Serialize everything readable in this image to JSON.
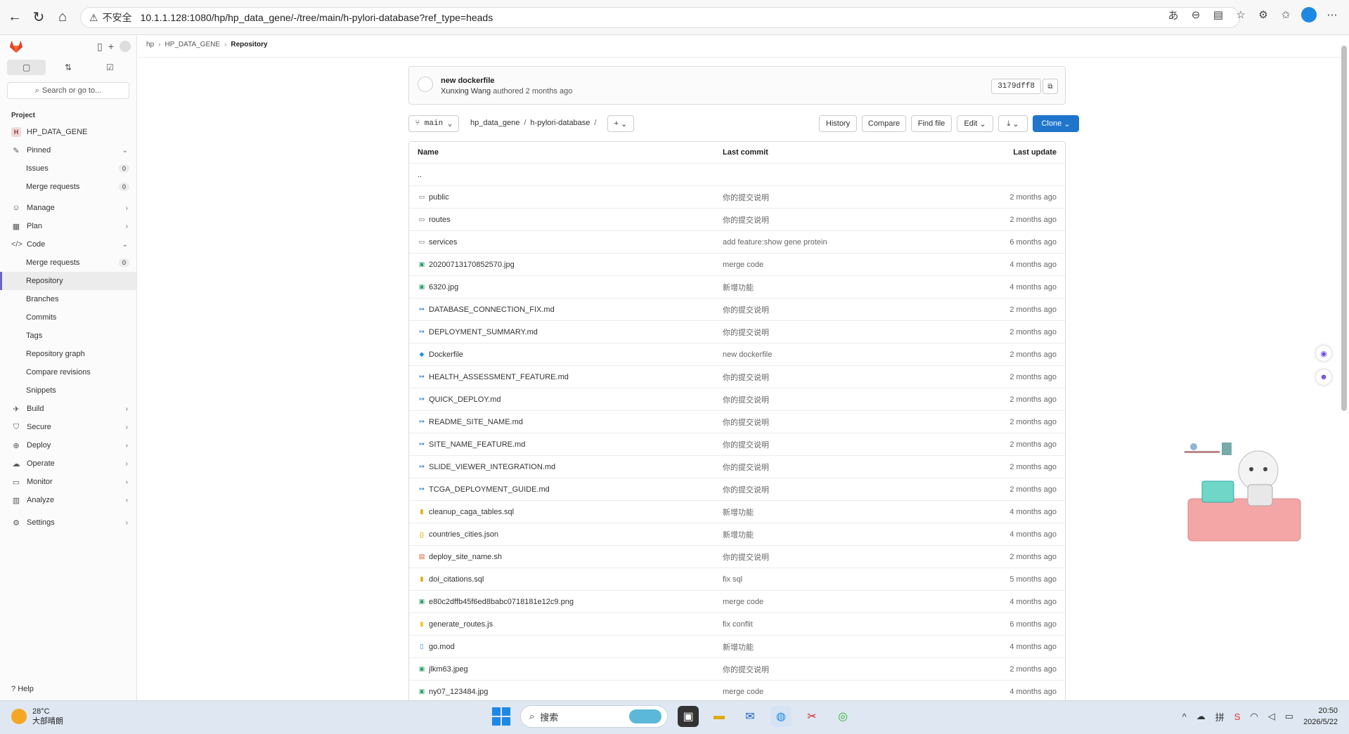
{
  "browser": {
    "insecure_label": "不安全",
    "url": "10.1.1.128:1080/hp/hp_data_gene/-/tree/main/h-pylori-database?ref_type=heads"
  },
  "sidebar": {
    "search_placeholder": "Search or go to...",
    "section_label": "Project",
    "project_initial": "H",
    "project_name": "HP_DATA_GENE",
    "pinned": "Pinned",
    "pinned_items": [
      {
        "label": "Issues",
        "count": "0"
      },
      {
        "label": "Merge requests",
        "count": "0"
      }
    ],
    "manage": "Manage",
    "plan": "Plan",
    "code": "Code",
    "code_items": [
      {
        "label": "Merge requests",
        "count": "0"
      },
      {
        "label": "Repository"
      },
      {
        "label": "Branches"
      },
      {
        "label": "Commits"
      },
      {
        "label": "Tags"
      },
      {
        "label": "Repository graph"
      },
      {
        "label": "Compare revisions"
      },
      {
        "label": "Snippets"
      }
    ],
    "build": "Build",
    "secure": "Secure",
    "deploy": "Deploy",
    "operate": "Operate",
    "monitor": "Monitor",
    "analyze": "Analyze",
    "settings": "Settings",
    "help": "Help"
  },
  "breadcrumb": {
    "items": [
      "hp",
      "HP_DATA_GENE",
      "Repository"
    ]
  },
  "commit": {
    "title": "new dockerfile",
    "author": "Xunxing Wang",
    "meta": "authored 2 months ago",
    "sha": "3179dff8"
  },
  "toolbar": {
    "branch": "main",
    "path_root": "hp_data_gene",
    "path_dir": "h-pylori-database",
    "history": "History",
    "compare": "Compare",
    "find_file": "Find file",
    "edit": "Edit",
    "clone": "Clone"
  },
  "table": {
    "headers": {
      "name": "Name",
      "commit": "Last commit",
      "date": "Last update"
    },
    "parent": "..",
    "rows": [
      {
        "name": "public",
        "type": "folder",
        "commit": "你的提交说明",
        "date": "2 months ago"
      },
      {
        "name": "routes",
        "type": "folder",
        "commit": "你的提交说明",
        "date": "2 months ago"
      },
      {
        "name": "services",
        "type": "folder",
        "commit": "add feature:show gene protein",
        "date": "6 months ago"
      },
      {
        "name": "20200713170852570.jpg",
        "type": "image",
        "commit": "merge code",
        "date": "4 months ago"
      },
      {
        "name": "6320.jpg",
        "type": "image",
        "commit": "新增功能",
        "date": "4 months ago"
      },
      {
        "name": "DATABASE_CONNECTION_FIX.md",
        "type": "md",
        "commit": "你的提交说明",
        "date": "2 months ago"
      },
      {
        "name": "DEPLOYMENT_SUMMARY.md",
        "type": "md",
        "commit": "你的提交说明",
        "date": "2 months ago"
      },
      {
        "name": "Dockerfile",
        "type": "docker",
        "commit": "new dockerfile",
        "date": "2 months ago"
      },
      {
        "name": "HEALTH_ASSESSMENT_FEATURE.md",
        "type": "md",
        "commit": "你的提交说明",
        "date": "2 months ago"
      },
      {
        "name": "QUICK_DEPLOY.md",
        "type": "md",
        "commit": "你的提交说明",
        "date": "2 months ago"
      },
      {
        "name": "README_SITE_NAME.md",
        "type": "md",
        "commit": "你的提交说明",
        "date": "2 months ago"
      },
      {
        "name": "SITE_NAME_FEATURE.md",
        "type": "md",
        "commit": "你的提交说明",
        "date": "2 months ago"
      },
      {
        "name": "SLIDE_VIEWER_INTEGRATION.md",
        "type": "md",
        "commit": "你的提交说明",
        "date": "2 months ago"
      },
      {
        "name": "TCGA_DEPLOYMENT_GUIDE.md",
        "type": "md",
        "commit": "你的提交说明",
        "date": "2 months ago"
      },
      {
        "name": "cleanup_caga_tables.sql",
        "type": "sql",
        "commit": "新增功能",
        "date": "4 months ago"
      },
      {
        "name": "countries_cities.json",
        "type": "json",
        "commit": "新增功能",
        "date": "4 months ago"
      },
      {
        "name": "deploy_site_name.sh",
        "type": "sh",
        "commit": "你的提交说明",
        "date": "2 months ago"
      },
      {
        "name": "doi_citations.sql",
        "type": "sql",
        "commit": "fix sql",
        "date": "5 months ago"
      },
      {
        "name": "e80c2dffb45f6ed8babc0718181e12c9.png",
        "type": "image",
        "commit": "merge code",
        "date": "4 months ago"
      },
      {
        "name": "generate_routes.js",
        "type": "js",
        "commit": "fix conflit",
        "date": "6 months ago"
      },
      {
        "name": "go.mod",
        "type": "file",
        "commit": "新增功能",
        "date": "4 months ago"
      },
      {
        "name": "jlkm63.jpeg",
        "type": "image",
        "commit": "你的提交说明",
        "date": "2 months ago"
      },
      {
        "name": "ny07_123484.jpg",
        "type": "image",
        "commit": "merge code",
        "date": "4 months ago"
      }
    ]
  },
  "taskbar": {
    "temperature": "28°C",
    "weather": "大部晴朗",
    "search": "搜索",
    "time": "20:50",
    "date": "2026/5/22"
  },
  "colors": {
    "accent": "#1f75cb",
    "sidebar_active": "#6666c4"
  }
}
